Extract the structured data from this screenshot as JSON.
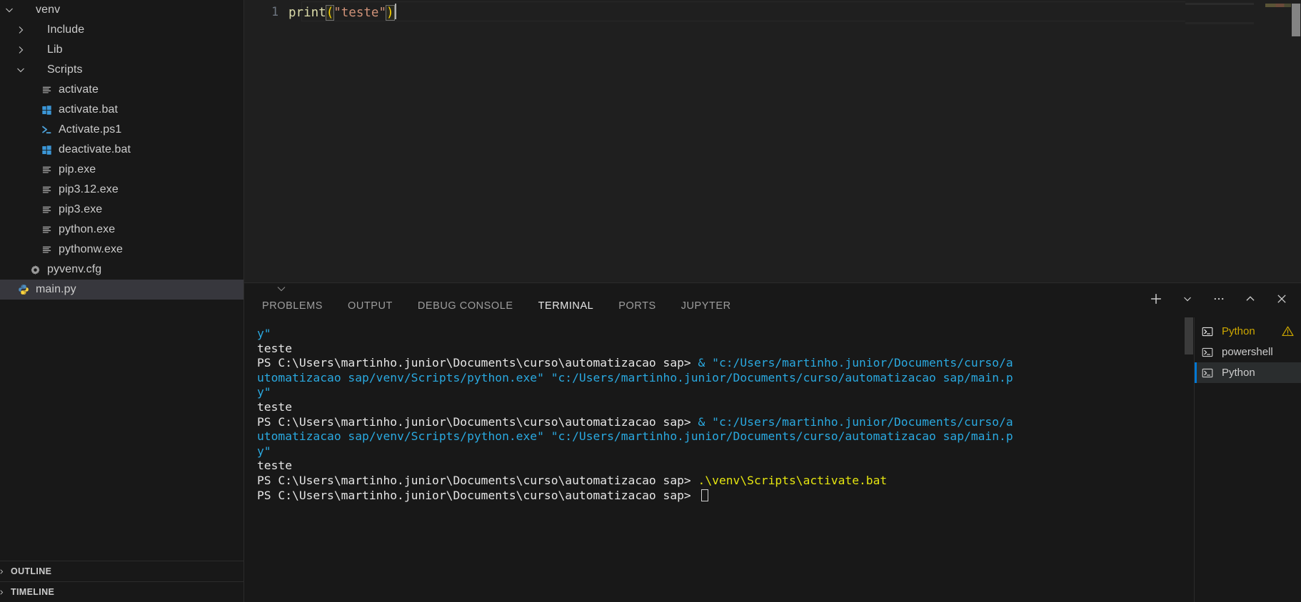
{
  "sidebar": {
    "tree": [
      {
        "label": "venv",
        "indent": 0,
        "twisty": "chevron-down-icon",
        "icon": "none",
        "selected": false
      },
      {
        "label": "Include",
        "indent": 1,
        "twisty": "chevron-right-icon",
        "icon": "none",
        "selected": false
      },
      {
        "label": "Lib",
        "indent": 1,
        "twisty": "chevron-right-icon",
        "icon": "none",
        "selected": false
      },
      {
        "label": "Scripts",
        "indent": 1,
        "twisty": "chevron-down-icon",
        "icon": "none",
        "selected": false
      },
      {
        "label": "activate",
        "indent": 2,
        "twisty": "none",
        "icon": "text-file-icon",
        "selected": false
      },
      {
        "label": "activate.bat",
        "indent": 2,
        "twisty": "none",
        "icon": "windows-icon",
        "selected": false
      },
      {
        "label": "Activate.ps1",
        "indent": 2,
        "twisty": "none",
        "icon": "powershell-icon",
        "selected": false
      },
      {
        "label": "deactivate.bat",
        "indent": 2,
        "twisty": "none",
        "icon": "windows-icon",
        "selected": false
      },
      {
        "label": "pip.exe",
        "indent": 2,
        "twisty": "none",
        "icon": "text-file-icon",
        "selected": false
      },
      {
        "label": "pip3.12.exe",
        "indent": 2,
        "twisty": "none",
        "icon": "text-file-icon",
        "selected": false
      },
      {
        "label": "pip3.exe",
        "indent": 2,
        "twisty": "none",
        "icon": "text-file-icon",
        "selected": false
      },
      {
        "label": "python.exe",
        "indent": 2,
        "twisty": "none",
        "icon": "text-file-icon",
        "selected": false
      },
      {
        "label": "pythonw.exe",
        "indent": 2,
        "twisty": "none",
        "icon": "text-file-icon",
        "selected": false
      },
      {
        "label": "pyvenv.cfg",
        "indent": 1,
        "twisty": "none",
        "icon": "gear-icon",
        "selected": false
      },
      {
        "label": "main.py",
        "indent": 0,
        "twisty": "none",
        "icon": "python-icon",
        "selected": true
      }
    ],
    "sections": [
      {
        "label": "OUTLINE"
      },
      {
        "label": "TIMELINE"
      }
    ]
  },
  "editor": {
    "line_number": "1",
    "code": {
      "fn": "print",
      "open_paren": "(",
      "string": "\"teste\"",
      "close_paren": ")"
    }
  },
  "panel": {
    "tabs": [
      {
        "label": "PROBLEMS",
        "active": false
      },
      {
        "label": "OUTPUT",
        "active": false
      },
      {
        "label": "DEBUG CONSOLE",
        "active": false
      },
      {
        "label": "TERMINAL",
        "active": true
      },
      {
        "label": "PORTS",
        "active": false
      },
      {
        "label": "JUPYTER",
        "active": false
      }
    ],
    "actions": [
      {
        "name": "new-terminal-button",
        "glyph": "plus-icon"
      },
      {
        "name": "terminal-profile-button",
        "glyph": "chevron-down-icon"
      },
      {
        "name": "panel-more-actions-button",
        "glyph": "ellipsis-icon"
      },
      {
        "name": "maximize-panel-button",
        "glyph": "chevron-up-icon"
      },
      {
        "name": "close-panel-button",
        "glyph": "close-icon"
      }
    ],
    "terminal_tabs": [
      {
        "label": "Python",
        "active": false,
        "warning": true,
        "icon": "terminal-icon"
      },
      {
        "label": "powershell",
        "active": false,
        "warning": false,
        "icon": "terminal-icon"
      },
      {
        "label": "Python",
        "active": true,
        "warning": false,
        "icon": "terminal-icon"
      }
    ],
    "terminal_output": [
      [
        {
          "t": "y\"",
          "c": "blue"
        }
      ],
      [
        {
          "t": "teste",
          "c": "white"
        }
      ],
      [
        {
          "t": "PS C:\\Users\\martinho.junior\\Documents\\curso\\automatizacao sap> ",
          "c": "white"
        },
        {
          "t": "& \"c:/Users/martinho.junior/Documents/curso/a",
          "c": "blue"
        }
      ],
      [
        {
          "t": "utomatizacao sap/venv/Scripts/python.exe\" \"c:/Users/martinho.junior/Documents/curso/automatizacao sap/main.p",
          "c": "blue"
        }
      ],
      [
        {
          "t": "y\"",
          "c": "blue"
        }
      ],
      [
        {
          "t": "teste",
          "c": "white"
        }
      ],
      [
        {
          "t": "PS C:\\Users\\martinho.junior\\Documents\\curso\\automatizacao sap> ",
          "c": "white"
        },
        {
          "t": "& \"c:/Users/martinho.junior/Documents/curso/a",
          "c": "blue"
        }
      ],
      [
        {
          "t": "utomatizacao sap/venv/Scripts/python.exe\" \"c:/Users/martinho.junior/Documents/curso/automatizacao sap/main.p",
          "c": "blue"
        }
      ],
      [
        {
          "t": "y\"",
          "c": "blue"
        }
      ],
      [
        {
          "t": "teste",
          "c": "white"
        }
      ],
      [
        {
          "t": "PS C:\\Users\\martinho.junior\\Documents\\curso\\automatizacao sap> ",
          "c": "white"
        },
        {
          "t": ".\\venv\\Scripts\\activate.bat",
          "c": "yellow"
        }
      ],
      [
        {
          "t": "PS C:\\Users\\martinho.junior\\Documents\\curso\\automatizacao sap> ",
          "c": "white"
        },
        {
          "t": "",
          "c": "cursor"
        }
      ]
    ]
  },
  "colors": {
    "accent": "#0078d4",
    "warning": "#cca700",
    "terminal_blue": "#2aa9e0",
    "terminal_yellow": "#e5e510",
    "selection": "#37373d"
  }
}
